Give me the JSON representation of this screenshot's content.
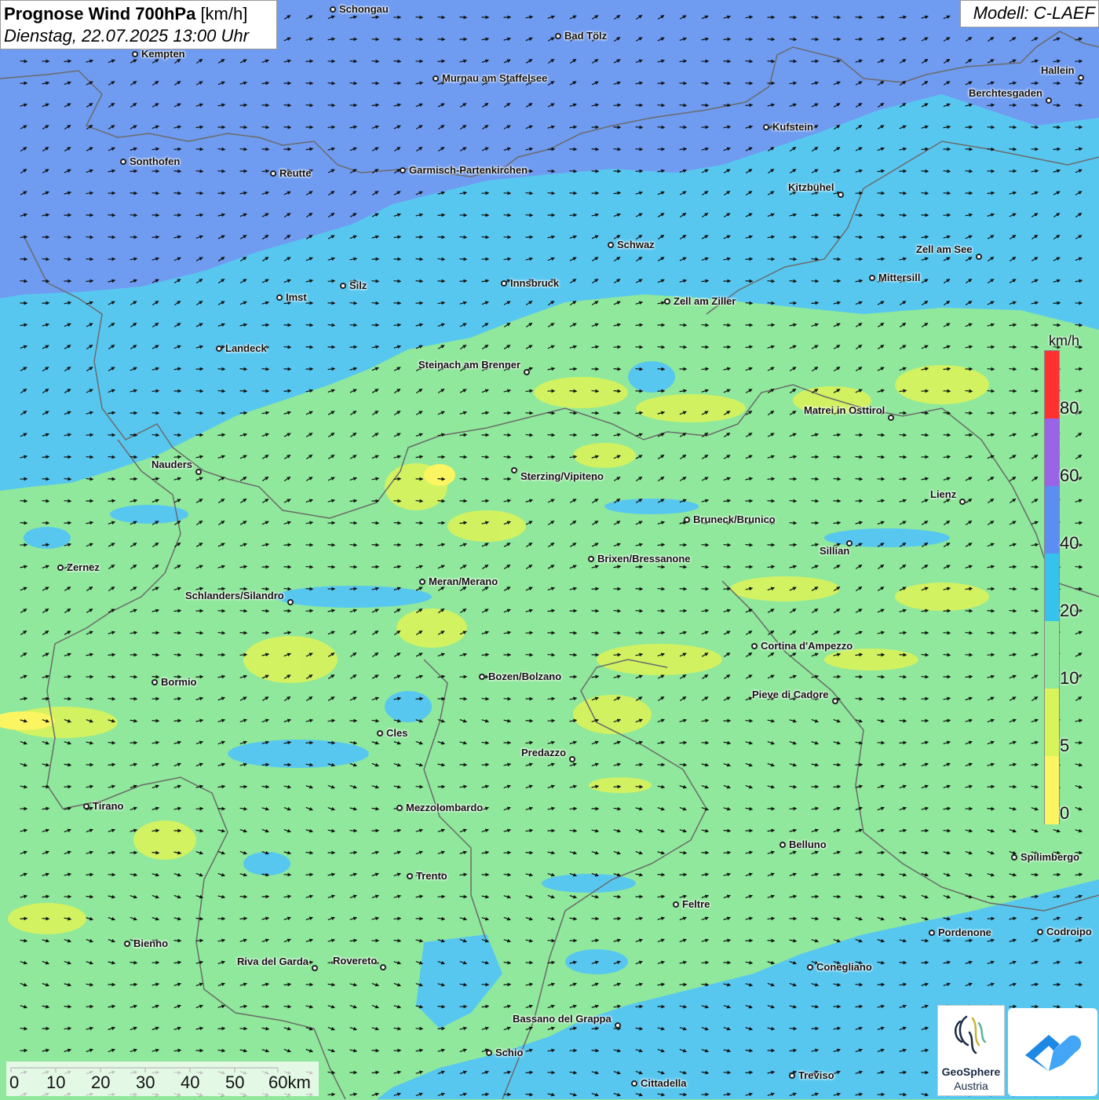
{
  "header": {
    "title_bold": "Prognose Wind 700hPa",
    "title_unit": "[km/h]",
    "date": "Dienstag, 22.07.2025 13:00 Uhr",
    "model": "Modell: C-LAEF"
  },
  "legend": {
    "unit": "km/h",
    "ticks": [
      "80",
      "60",
      "40",
      "20",
      "10",
      "5",
      "0"
    ],
    "colors": [
      "#ff3030",
      "#9a63e8",
      "#5b8ef2",
      "#35c3ee",
      "#8fe89b",
      "#d9f35b",
      "#fbf562"
    ]
  },
  "scalebar": {
    "ticks": [
      "0",
      "10",
      "20",
      "30",
      "40",
      "50",
      "60km"
    ]
  },
  "logos": {
    "geosphere_line1": "GeoSphere",
    "geosphere_line2": "Austria"
  },
  "cities": [
    {
      "name": "Schongau"
    },
    {
      "name": "Bad Tölz"
    },
    {
      "name": "Kempten"
    },
    {
      "name": "Murnau am Staffelsee"
    },
    {
      "name": "Hallein"
    },
    {
      "name": "Berchtesgaden"
    },
    {
      "name": "Kufstein"
    },
    {
      "name": "Sonthofen"
    },
    {
      "name": "Reutte"
    },
    {
      "name": "Garmisch-Partenkirchen"
    },
    {
      "name": "Kitzbühel"
    },
    {
      "name": "Schwaz"
    },
    {
      "name": "Zell am See"
    },
    {
      "name": "Mittersill"
    },
    {
      "name": "Imst"
    },
    {
      "name": "Silz"
    },
    {
      "name": "Innsbruck"
    },
    {
      "name": "Zell am Ziller"
    },
    {
      "name": "Landeck"
    },
    {
      "name": "Steinach am Brenner"
    },
    {
      "name": "Matrei in Osttirol"
    },
    {
      "name": "Nauders"
    },
    {
      "name": "Sterzing/Vipiteno"
    },
    {
      "name": "Lienz"
    },
    {
      "name": "Bruneck/Brunico"
    },
    {
      "name": "Sillian"
    },
    {
      "name": "Zernez"
    },
    {
      "name": "Brixen/Bressanone"
    },
    {
      "name": "Meran/Merano"
    },
    {
      "name": "Schlanders/Silandro"
    },
    {
      "name": "Cortina d'Ampezzo"
    },
    {
      "name": "Bozen/Bolzano"
    },
    {
      "name": "Bormio"
    },
    {
      "name": "Pieve di Cadore"
    },
    {
      "name": "Cles"
    },
    {
      "name": "Predazzo"
    },
    {
      "name": "Tirano"
    },
    {
      "name": "Mezzolombardo"
    },
    {
      "name": "Belluno"
    },
    {
      "name": "Spilimbergo"
    },
    {
      "name": "Trento"
    },
    {
      "name": "Feltre"
    },
    {
      "name": "Pordenone"
    },
    {
      "name": "Codroipo"
    },
    {
      "name": "Bienno"
    },
    {
      "name": "Riva del Garda"
    },
    {
      "name": "Rovereto"
    },
    {
      "name": "Conegliano"
    },
    {
      "name": "Bassano del Grappa"
    },
    {
      "name": "Schio"
    },
    {
      "name": "Treviso"
    },
    {
      "name": "Cittadella"
    }
  ]
}
